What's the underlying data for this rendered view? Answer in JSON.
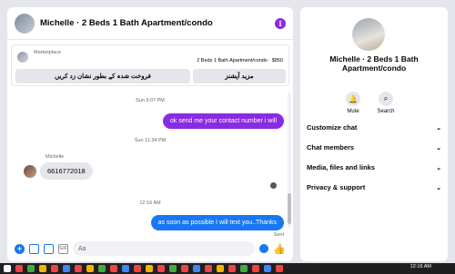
{
  "chat": {
    "title": "Michelle · 2 Beds 1 Bath Apartment/condo",
    "marketplace_label": "Marketplace",
    "listing": "2 Beds 1 Bath Apartment/condo · $850",
    "btn_mark_sold": "فروخت شدہ کے بطور نشان زد کریں",
    "btn_more": "مزید آپشنز"
  },
  "messages": {
    "ts1": "Sun 9:07 PM",
    "msg1": "ok send me your contact number i will",
    "ts2": "Sun 11:34 PM",
    "sender": "Michelle",
    "msg2": "6616772018",
    "ts3": "12:16 AM",
    "msg3": "as soon as possible I will text you..Thanks",
    "sent": "Sent"
  },
  "composer": {
    "placeholder": "Aa"
  },
  "side": {
    "title": "Michelle · 2 Beds 1 Bath Apartment/condo",
    "mute": "Mute",
    "search": "Search",
    "rows": [
      "Customize chat",
      "Chat members",
      "Media, files and links",
      "Privacy & support"
    ]
  },
  "taskbar": {
    "time": "12:16 AM"
  },
  "colors": {
    "accent": "#8a2be2",
    "blue": "#1877f2"
  }
}
